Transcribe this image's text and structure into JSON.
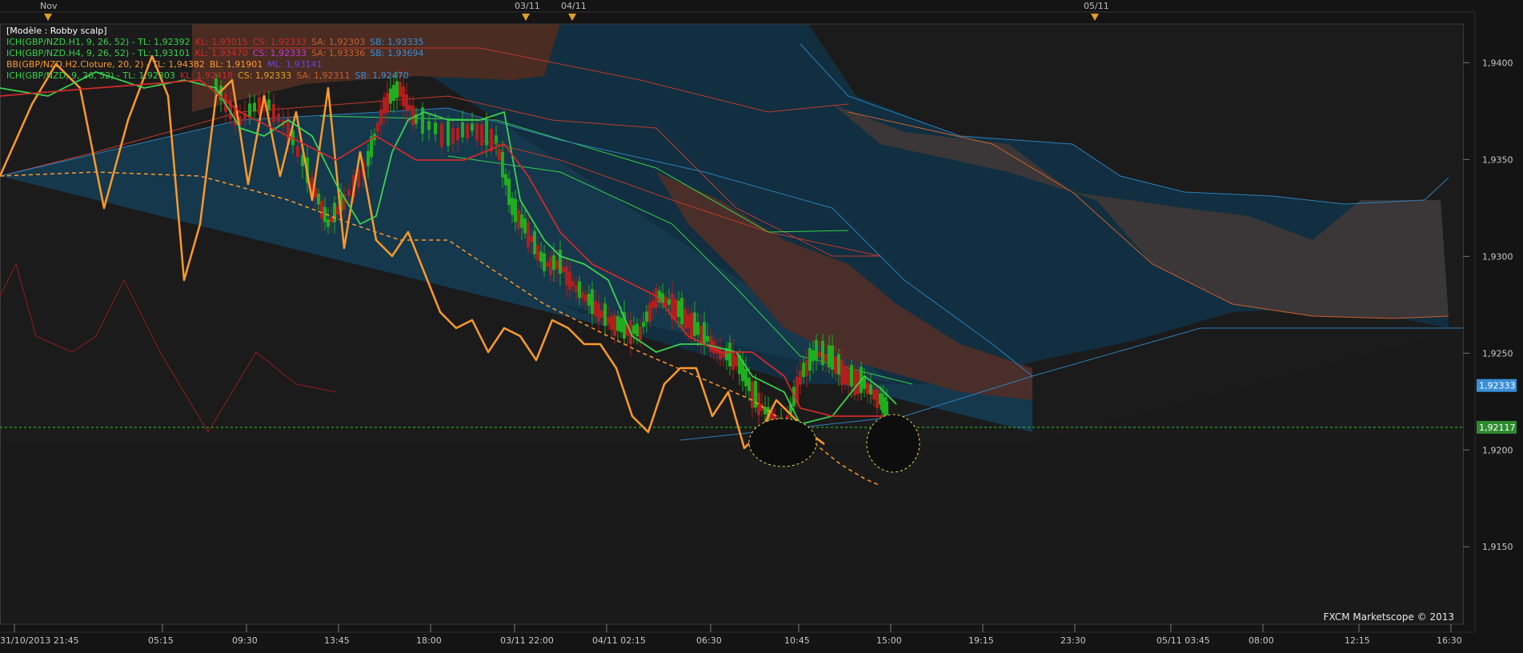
{
  "chart_data": {
    "type": "candlestick",
    "ylim": [
      1.911,
      1.942
    ],
    "y_ticks": [
      "1,9400",
      "1,9350",
      "1,9300",
      "1,9250",
      "1,9200",
      "1,9150"
    ],
    "y_tick_values": [
      1.94,
      1.935,
      1.93,
      1.925,
      1.92,
      1.915
    ],
    "x_ticks": [
      "31/10/2013 21:45",
      "05:15",
      "09:30",
      "13:45",
      "18:00",
      "03/11 22:00",
      "04/11 02:15",
      "06:30",
      "10:45",
      "15:00",
      "19:15",
      "23:30",
      "05/11 03:45",
      "08:00",
      "12:15",
      "16:30"
    ],
    "top_markers": [
      "Nov",
      "03/11",
      "04/11",
      "05/11"
    ],
    "price_tags": [
      {
        "label": "1,92333",
        "value": 1.92333,
        "color": "#3a8fd8"
      },
      {
        "label": "1,92117",
        "value": 1.92117,
        "color": "#2f8a2f"
      }
    ],
    "horizontal_line": 1.92117,
    "legend": {
      "title": "[Modèle : Robby scalp]",
      "rows": [
        [
          {
            "t": "ICH(GBP/NZD.H1, 9, 26, 52) -  TL: 1,92392",
            "c": "#37d24a"
          },
          {
            "t": "KL: 1,93015",
            "c": "#d02a2a"
          },
          {
            "t": "CS: 1,92333",
            "c": "#d02a2a"
          },
          {
            "t": "SA: 1,92303",
            "c": "#c9602c"
          },
          {
            "t": "SB: 1,93335",
            "c": "#3a8fd8"
          }
        ],
        [
          {
            "t": "ICH(GBP/NZD.H4, 9, 26, 52) -  TL: 1,93101",
            "c": "#37d24a"
          },
          {
            "t": "KL: 1,93470",
            "c": "#d02a2a"
          },
          {
            "t": "CS: 1,92333",
            "c": "#c33ad8"
          },
          {
            "t": "SA: 1,93336",
            "c": "#c9602c"
          },
          {
            "t": "SB: 1,93694",
            "c": "#3a8fd8"
          }
        ],
        [
          {
            "t": "BB(GBP/NZD.H2.Cloture, 20, 2) -  TL: 1,94382",
            "c": "#ff9a2a"
          },
          {
            "t": "BL: 1,91901",
            "c": "#ff9a2a"
          },
          {
            "t": "ML: 1,93141",
            "c": "#6a48d8"
          }
        ],
        [
          {
            "t": "ICH(GBP/NZD, 9, 26, 52) -  TL: 1,92303",
            "c": "#37d24a"
          },
          {
            "t": "KL: 1,92418",
            "c": "#d02a2a"
          },
          {
            "t": "CS: 1,92333",
            "c": "#e0a020"
          },
          {
            "t": "SA: 1,92311",
            "c": "#c9602c"
          },
          {
            "t": "SB: 1,92470",
            "c": "#3a8fd8"
          }
        ]
      ]
    },
    "watermark": "FXCM Marketscope © 2013",
    "colors": {
      "bull": "#1fae1f",
      "bear": "#b01e1e",
      "cloud_blue": "#1a3a4e",
      "cloud_red": "#5a3030",
      "bb": "#ff9a2a",
      "tenkan": "#37d24a",
      "kijun": "#d02a2a"
    }
  }
}
